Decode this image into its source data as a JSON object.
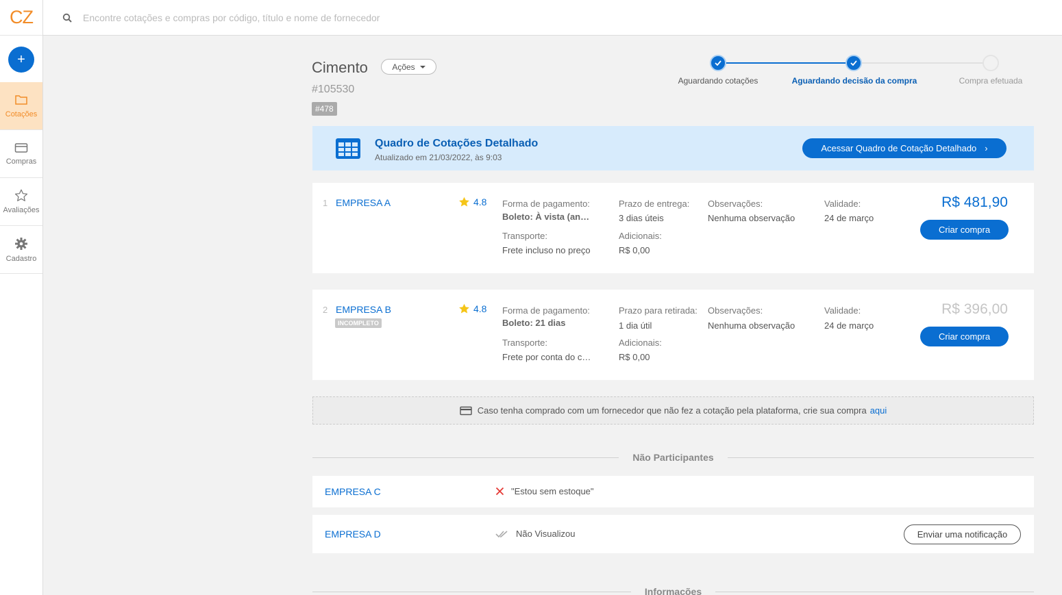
{
  "app": {
    "logo": "CZ"
  },
  "sidebar": {
    "add_label": "+",
    "items": [
      {
        "label": "Cotações",
        "icon": "folder-icon",
        "active": true
      },
      {
        "label": "Compras",
        "icon": "card-icon",
        "active": false
      },
      {
        "label": "Avaliações",
        "icon": "star-icon",
        "active": false
      },
      {
        "label": "Cadastro",
        "icon": "gear-icon",
        "active": false
      }
    ]
  },
  "search": {
    "placeholder": "Encontre cotações e compras por código, título e nome de fornecedor",
    "value": ""
  },
  "header": {
    "title": "Cimento",
    "actions_label": "Ações",
    "code": "#105530",
    "tag": "#478"
  },
  "steps": [
    {
      "label": "Aguardando cotações",
      "state": "done"
    },
    {
      "label": "Aguardando decisão da compra",
      "state": "current"
    },
    {
      "label": "Compra efetuada",
      "state": "todo"
    }
  ],
  "banner": {
    "title": "Quadro de Cotações Detalhado",
    "subtitle": "Atualizado em 21/03/2022, às 9:03",
    "button_label": "Acessar Quadro de Cotação Detalhado",
    "button_chevron": "›"
  },
  "quotes": [
    {
      "index": "1",
      "company": "EMPRESA A",
      "badge": "",
      "rating": "4.8",
      "payment_label": "Forma de pagamento:",
      "payment_value": "Boleto: À vista (antecipado)",
      "transport_label": "Transporte:",
      "transport_value": "Frete incluso no preço",
      "delivery_label": "Prazo de entrega:",
      "delivery_value": "3 dias úteis",
      "additional_label": "Adicionais:",
      "additional_value": "R$ 0,00",
      "notes_label": "Observações:",
      "notes_value": "Nenhuma observação",
      "validity_label": "Validade:",
      "validity_value": "24 de março",
      "price": "R$ 481,90",
      "button_label": "Criar compra"
    },
    {
      "index": "2",
      "company": "EMPRESA B",
      "badge": "INCOMPLETO",
      "rating": "4.8",
      "payment_label": "Forma de pagamento:",
      "payment_value": "Boleto: 21 dias",
      "transport_label": "Transporte:",
      "transport_value": "Frete por conta do cliente",
      "delivery_label": "Prazo para retirada:",
      "delivery_value": "1 dia útil",
      "additional_label": "Adicionais:",
      "additional_value": "R$ 0,00",
      "notes_label": "Observações:",
      "notes_value": "Nenhuma observação",
      "validity_label": "Validade:",
      "validity_value": "24 de março",
      "price": "R$ 396,00",
      "button_label": "Criar compra"
    }
  ],
  "notice": {
    "text": "Caso tenha comprado com um fornecedor que não fez a cotação pela plataforma, crie sua compra",
    "link": "aqui"
  },
  "non_participants": {
    "title": "Não Participantes",
    "rows": [
      {
        "company": "EMPRESA C",
        "status": "\"Estou sem estoque\"",
        "icon": "x-icon"
      },
      {
        "company": "EMPRESA D",
        "status": "Não Visualizou",
        "icon": "double-check-icon",
        "button_label": "Enviar uma notificação"
      }
    ]
  },
  "info_section": {
    "title": "Informações"
  },
  "colors": {
    "primary": "#0a6ed1",
    "brand": "#f28c28",
    "banner_bg": "#d7ebfc",
    "star": "#f5c518",
    "error": "#e53935"
  }
}
